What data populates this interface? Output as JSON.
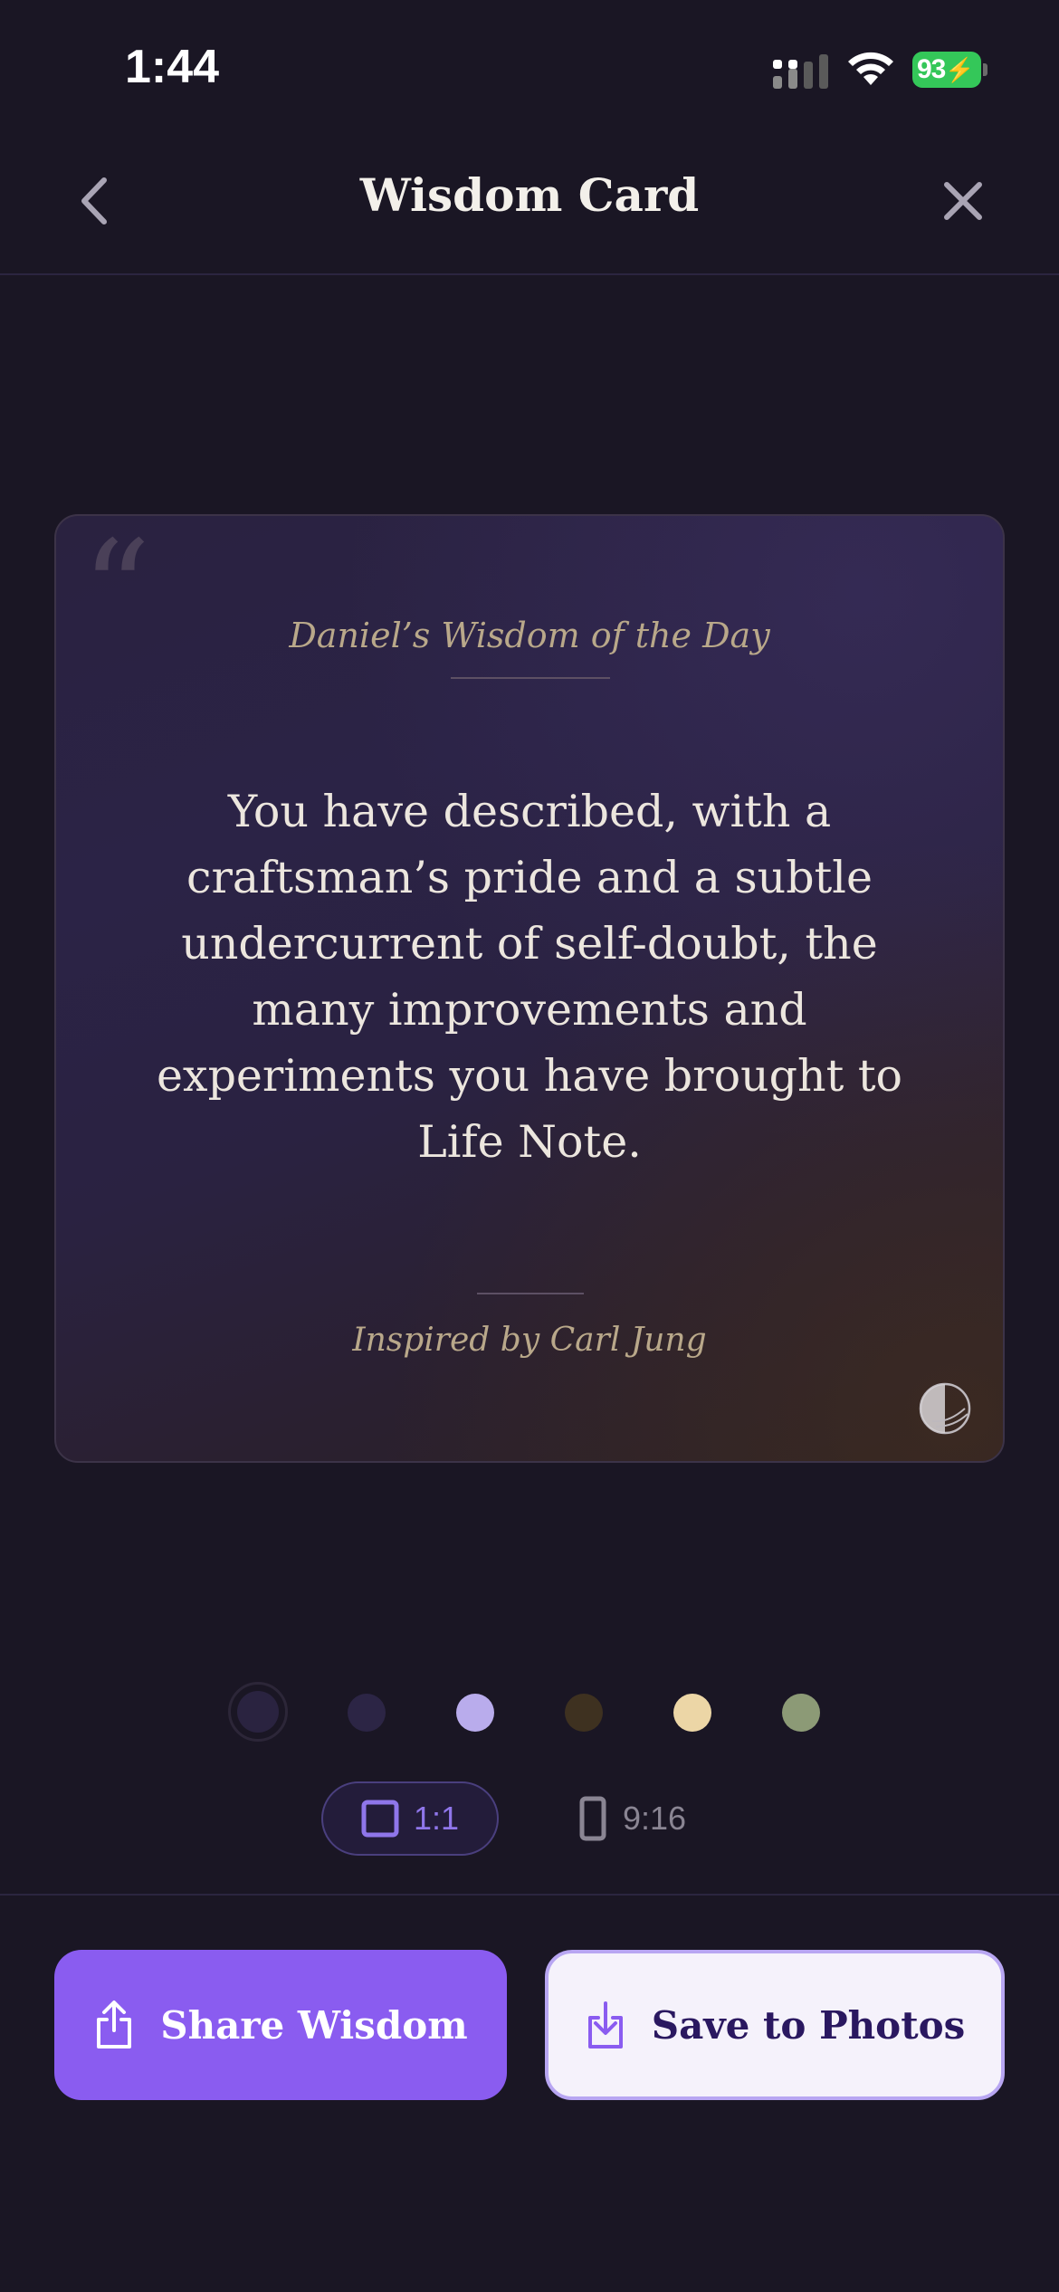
{
  "status_bar": {
    "time": "1:44",
    "battery_percent": "93",
    "icons": [
      "signal-icon",
      "wifi-icon",
      "battery-charging-icon"
    ]
  },
  "header": {
    "title": "Wisdom Card",
    "back_icon": "chevron-left-icon",
    "close_icon": "close-icon"
  },
  "card": {
    "heading": "Daniel’s Wisdom of the Day",
    "quote": "You have described, with a craftsman’s pride and a subtle undercurrent of self-doubt, the many improvements and experiments you have brought to Life Note.",
    "attribution": "Inspired by Carl Jung",
    "quote_mark_icon": "quote-mark-icon",
    "logo_icon": "life-note-logo-icon"
  },
  "color_options": [
    {
      "name": "midnight",
      "color": "#2a2340",
      "selected": true
    },
    {
      "name": "indigo",
      "color": "#2c2545",
      "selected": false
    },
    {
      "name": "lavender",
      "color": "#b9acec",
      "selected": false
    },
    {
      "name": "umber",
      "color": "#3e3120",
      "selected": false
    },
    {
      "name": "cream",
      "color": "#ecd6a6",
      "selected": false
    },
    {
      "name": "sage",
      "color": "#8c9a76",
      "selected": false
    }
  ],
  "aspect_options": [
    {
      "label": "1:1",
      "icon": "square-icon",
      "selected": true
    },
    {
      "label": "9:16",
      "icon": "portrait-rectangle-icon",
      "selected": false
    }
  ],
  "actions": {
    "share_label": "Share Wisdom",
    "share_icon": "share-icon",
    "save_label": "Save to Photos",
    "save_icon": "download-icon"
  },
  "colors": {
    "background": "#1a1624",
    "accent": "#8a5cf0",
    "card_text": "#ece6de",
    "card_muted": "#b9a88a"
  }
}
